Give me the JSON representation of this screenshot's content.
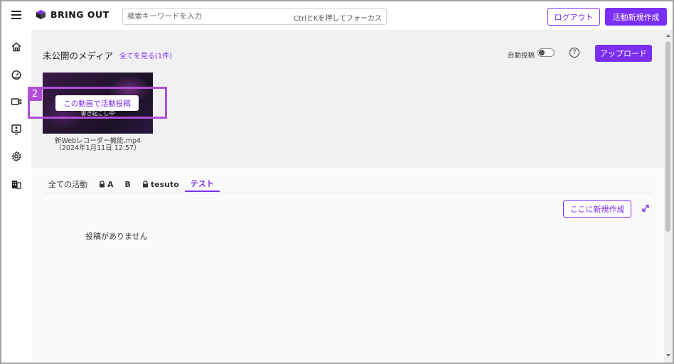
{
  "header": {
    "brand": "BRING OUT",
    "search_placeholder": "検索キーワードを入力",
    "search_hint": "CtrlとKを押してフォーカス",
    "logout_label": "ログアウト",
    "new_activity_label": "活動新規作成"
  },
  "sidebar": {
    "items": [
      {
        "icon": "home-icon"
      },
      {
        "icon": "dashboard-icon"
      },
      {
        "icon": "video-icon"
      },
      {
        "icon": "presentation-icon"
      },
      {
        "icon": "gear-icon"
      },
      {
        "icon": "building-icon"
      }
    ]
  },
  "media": {
    "title": "未公開のメディア",
    "see_all": "全てを見る(1件)",
    "auto_post_label": "自動投稿",
    "auto_post_on": false,
    "help": "?",
    "upload_label": "アップロード",
    "thumb_caption": "書き起こし中",
    "post_button": "この動画で活動投稿",
    "highlight_number": "2",
    "file_name": "新Webレコーダー機能.mp4",
    "file_date": "（2024年1月11日 12:57）"
  },
  "activity": {
    "tabs": [
      {
        "label": "全ての活動",
        "locked": false,
        "active": false
      },
      {
        "label": "A",
        "locked": true,
        "active": false
      },
      {
        "label": "B",
        "locked": false,
        "active": false
      },
      {
        "label": "tesuto",
        "locked": true,
        "active": false
      },
      {
        "label": "テスト",
        "locked": false,
        "active": true
      }
    ],
    "create_here_label": "ここに新規作成",
    "empty_message": "投稿がありません"
  },
  "colors": {
    "accent": "#7b2ff2",
    "highlight": "#b04fd6",
    "media_bg": "#f1f1f4"
  }
}
